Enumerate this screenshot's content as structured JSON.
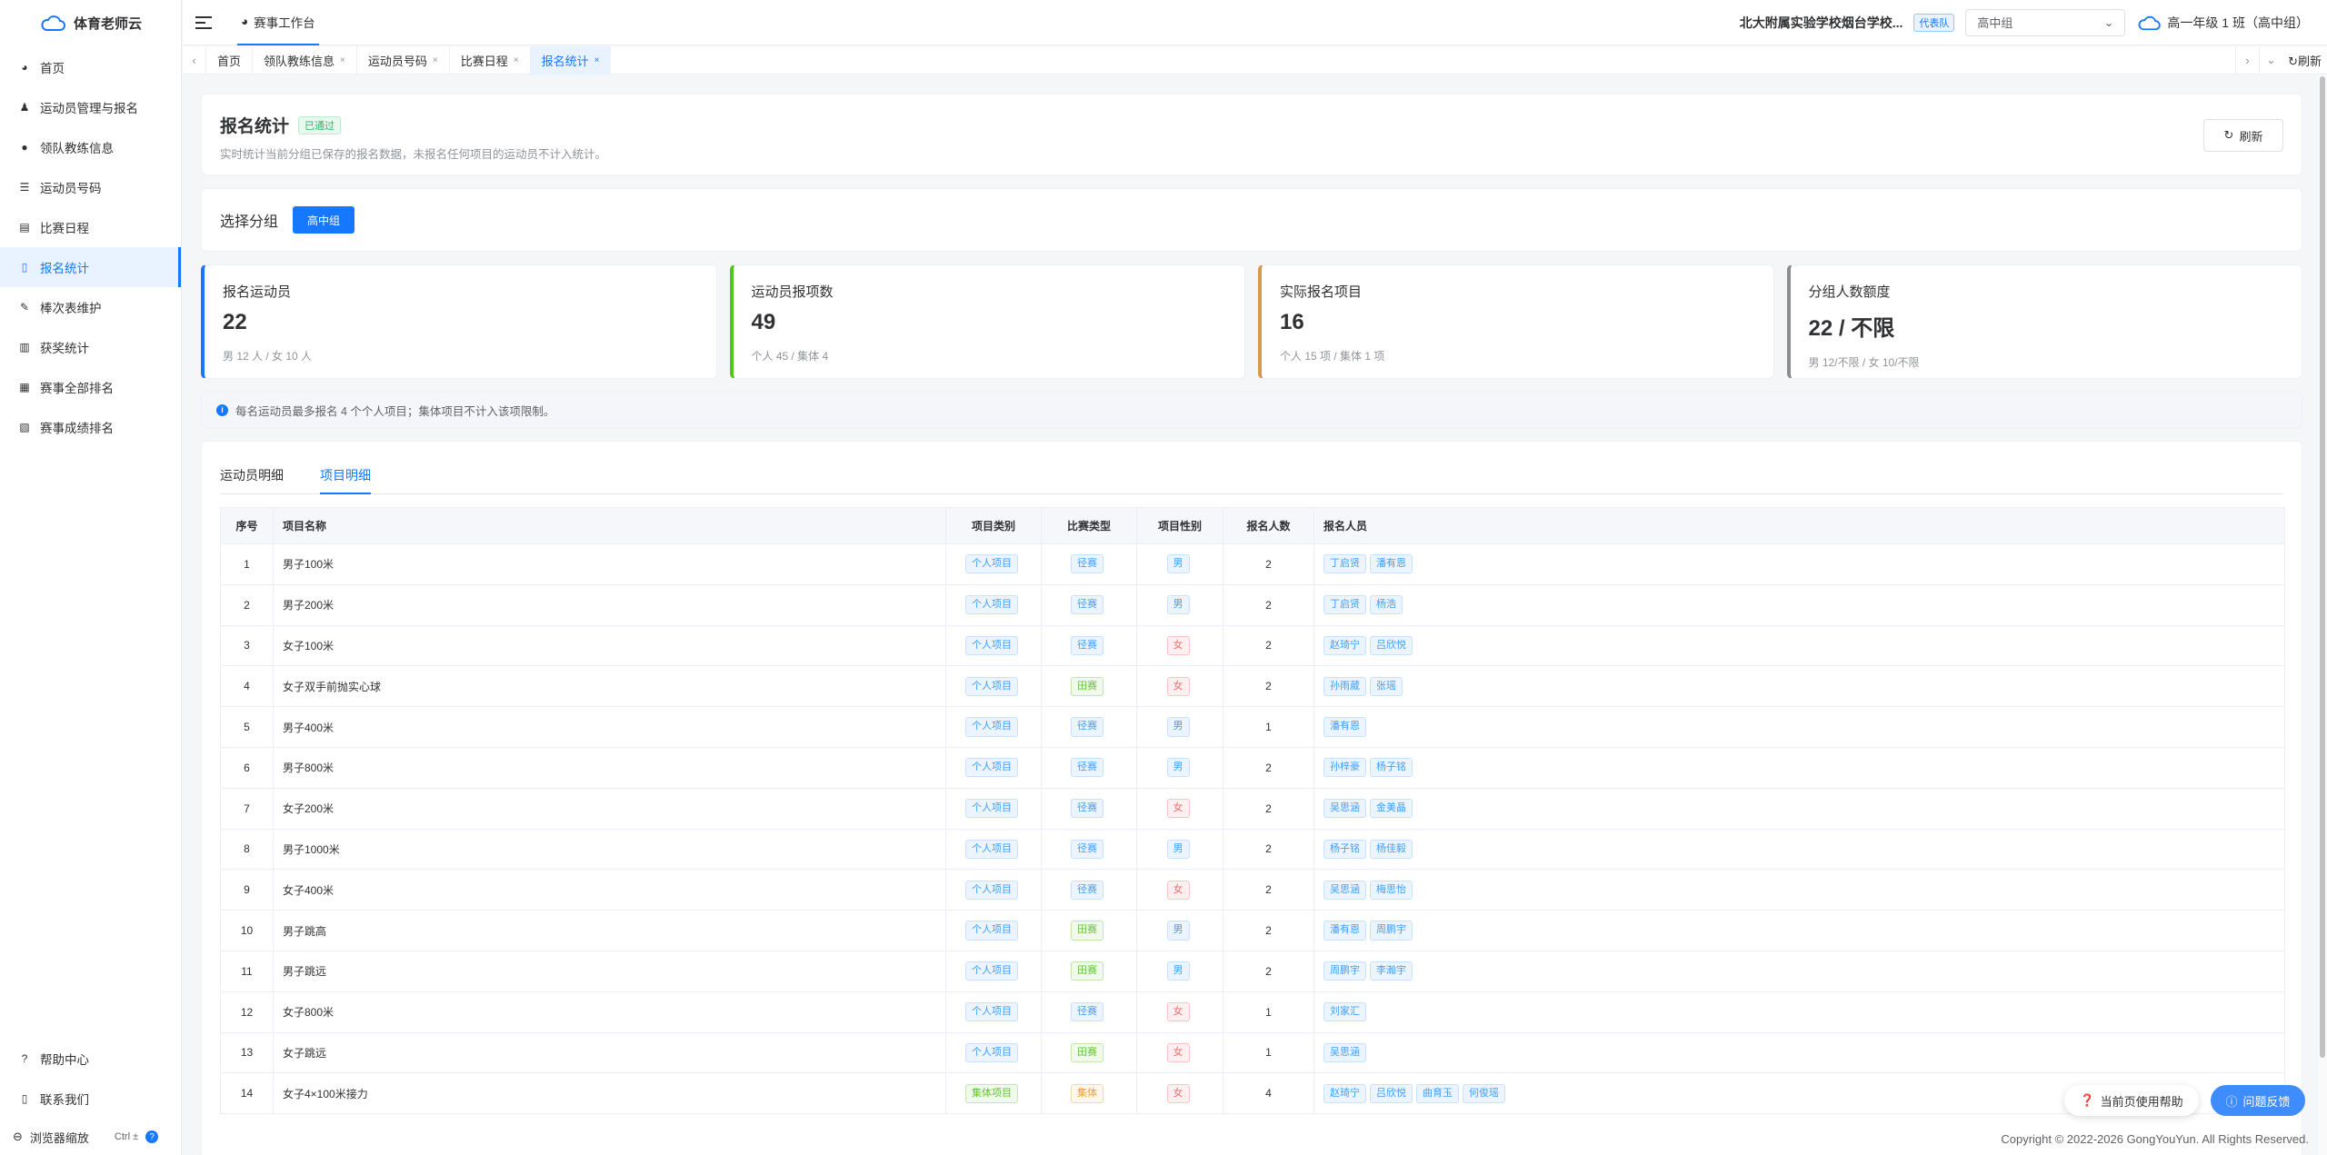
{
  "app": {
    "name": "体育老师云"
  },
  "sidebar": {
    "items": [
      {
        "label": "首页",
        "icon": "dashboard-icon"
      },
      {
        "label": "运动员管理与报名",
        "icon": "users-icon"
      },
      {
        "label": "领队教练信息",
        "icon": "user-icon"
      },
      {
        "label": "运动员号码",
        "icon": "list-icon"
      },
      {
        "label": "比赛日程",
        "icon": "calendar-icon"
      },
      {
        "label": "报名统计",
        "icon": "document-icon",
        "active": true
      },
      {
        "label": "棒次表维护",
        "icon": "edit-icon"
      },
      {
        "label": "获奖统计",
        "icon": "chart-icon"
      },
      {
        "label": "赛事全部排名",
        "icon": "bar-chart-icon"
      },
      {
        "label": "赛事成绩排名",
        "icon": "doc-chart-icon"
      }
    ],
    "bottom": {
      "help": "帮助中心",
      "contact": "联系我们",
      "zoom": "浏览器缩放",
      "zoom_shortcut": "Ctrl ±"
    }
  },
  "header": {
    "workspace_tab": "赛事工作台",
    "school": "北大附属实验学校烟台学校...",
    "rep_badge": "代表队",
    "group_select": "高中组",
    "class_name": "高一年级 1 班（高中组）"
  },
  "tabs": {
    "items": [
      "首页",
      "领队教练信息",
      "运动员号码",
      "比赛日程",
      "报名统计"
    ],
    "refresh": "刷新"
  },
  "page": {
    "title": "报名统计",
    "status": "已通过",
    "subtitle": "实时统计当前分组已保存的报名数据，未报名任何项目的运动员不计入统计。",
    "refresh_button": "刷新",
    "group_label": "选择分组",
    "group_button": "高中组"
  },
  "stats": [
    {
      "label": "报名运动员",
      "value": "22",
      "detail": "男 12 人 / 女 10 人",
      "color": "#1677ff"
    },
    {
      "label": "运动员报项数",
      "value": "49",
      "detail": "个人 45 / 集体 4",
      "color": "#52c41a"
    },
    {
      "label": "实际报名项目",
      "value": "16",
      "detail": "个人 15 项 / 集体 1 项",
      "color": "#d89a4a"
    },
    {
      "label": "分组人数额度",
      "value": "22 / 不限",
      "detail": "男 12/不限 / 女 10/不限",
      "color": "#8c8c8c"
    }
  ],
  "notice": "每名运动员最多报名 4 个个人项目；集体项目不计入该项限制。",
  "detail_tabs": [
    "运动员明细",
    "项目明细"
  ],
  "table": {
    "headers": [
      "序号",
      "项目名称",
      "项目类别",
      "比赛类型",
      "项目性别",
      "报名人数",
      "报名人员"
    ],
    "rows": [
      {
        "no": "1",
        "name": "男子100米",
        "category": "个人项目",
        "type": "径赛",
        "gender": "男",
        "count": "2",
        "people": [
          "丁启贤",
          "潘有恩"
        ]
      },
      {
        "no": "2",
        "name": "男子200米",
        "category": "个人项目",
        "type": "径赛",
        "gender": "男",
        "count": "2",
        "people": [
          "丁启贤",
          "杨浩"
        ]
      },
      {
        "no": "3",
        "name": "女子100米",
        "category": "个人项目",
        "type": "径赛",
        "gender": "女",
        "count": "2",
        "people": [
          "赵琦宁",
          "吕欣悦"
        ]
      },
      {
        "no": "4",
        "name": "女子双手前抛实心球",
        "category": "个人项目",
        "type": "田赛",
        "gender": "女",
        "count": "2",
        "people": [
          "孙雨葳",
          "张瑶"
        ]
      },
      {
        "no": "5",
        "name": "男子400米",
        "category": "个人项目",
        "type": "径赛",
        "gender": "男",
        "count": "1",
        "people": [
          "潘有恩"
        ]
      },
      {
        "no": "6",
        "name": "男子800米",
        "category": "个人项目",
        "type": "径赛",
        "gender": "男",
        "count": "2",
        "people": [
          "孙梓豪",
          "杨子铭"
        ]
      },
      {
        "no": "7",
        "name": "女子200米",
        "category": "个人项目",
        "type": "径赛",
        "gender": "女",
        "count": "2",
        "people": [
          "吴思涵",
          "金美晶"
        ]
      },
      {
        "no": "8",
        "name": "男子1000米",
        "category": "个人项目",
        "type": "径赛",
        "gender": "男",
        "count": "2",
        "people": [
          "杨子铭",
          "杨佳毅"
        ]
      },
      {
        "no": "9",
        "name": "女子400米",
        "category": "个人项目",
        "type": "径赛",
        "gender": "女",
        "count": "2",
        "people": [
          "吴思涵",
          "梅思怡"
        ]
      },
      {
        "no": "10",
        "name": "男子跳高",
        "category": "个人项目",
        "type": "田赛",
        "gender": "男",
        "count": "2",
        "people": [
          "潘有恩",
          "周鹏宇"
        ]
      },
      {
        "no": "11",
        "name": "男子跳远",
        "category": "个人项目",
        "type": "田赛",
        "gender": "男",
        "count": "2",
        "people": [
          "周鹏宇",
          "李瀚宇"
        ]
      },
      {
        "no": "12",
        "name": "女子800米",
        "category": "个人项目",
        "type": "径赛",
        "gender": "女",
        "count": "1",
        "people": [
          "刘家汇"
        ]
      },
      {
        "no": "13",
        "name": "女子跳远",
        "category": "个人项目",
        "type": "田赛",
        "gender": "女",
        "count": "1",
        "people": [
          "吴思涵"
        ]
      },
      {
        "no": "14",
        "name": "女子4×100米接力",
        "category": "集体项目",
        "type": "集体",
        "gender": "女",
        "count": "4",
        "people": [
          "赵琦宁",
          "吕欣悦",
          "曲育玉",
          "何俊瑶"
        ]
      }
    ]
  },
  "footer": "Copyright © 2022-2026 GongYouYun. All Rights Reserved.",
  "float": {
    "help": "当前页使用帮助",
    "feedback": "问题反馈"
  }
}
